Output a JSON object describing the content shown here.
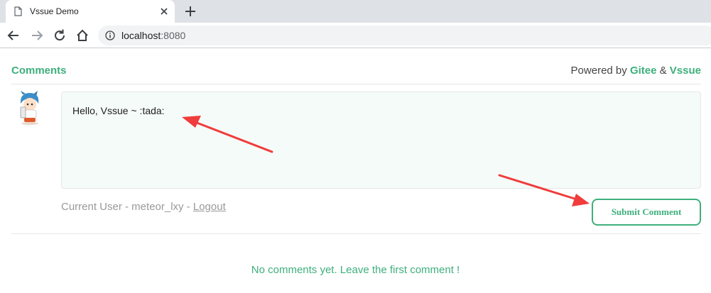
{
  "browser": {
    "tab_title": "Vssue Demo",
    "url_host": "localhost",
    "url_port": ":8080"
  },
  "page": {
    "comments_title": "Comments",
    "powered_by_prefix": "Powered by ",
    "powered_by_gitee": "Gitee",
    "powered_by_amp": " & ",
    "powered_by_vssue": "Vssue",
    "comment_text": "Hello, Vssue ~ :tada:",
    "current_user_prefix": "Current User - meteor_lxy - ",
    "logout_label": "Logout",
    "submit_label": "Submit Comment",
    "no_comments_text": "No comments yet. Leave the first comment !"
  },
  "colors": {
    "accent": "#3eaf7c",
    "annotation_arrow": "#f03c3c"
  }
}
